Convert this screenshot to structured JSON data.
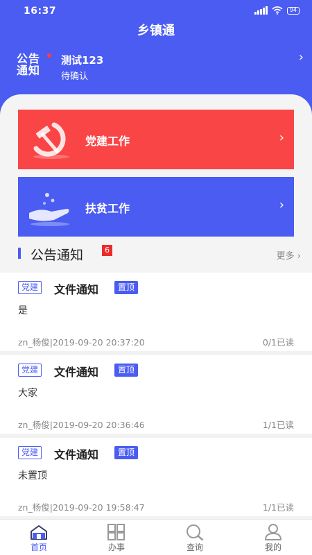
{
  "status_bar": {
    "time": "16:37",
    "battery": "94"
  },
  "header": {
    "title": "乡镇通"
  },
  "notice": {
    "logo_line1": "公告",
    "logo_line2": "通知",
    "title": "测试123",
    "status": "待确认"
  },
  "banners": [
    {
      "label": "党建工作",
      "icon": "hammer-sickle-icon",
      "color": "#fa4546"
    },
    {
      "label": "扶贫工作",
      "icon": "helping-hand-icon",
      "color": "#4a5cf2"
    }
  ],
  "announcements": {
    "title": "公告通知",
    "badge": "6",
    "more": "更多",
    "items": [
      {
        "tag": "党建",
        "title": "文件通知",
        "pin": "置顶",
        "body": "是",
        "meta": "zn_杨俊|2019-09-20 20:37:20",
        "read": "0/1已读"
      },
      {
        "tag": "党建",
        "title": "文件通知",
        "pin": "置顶",
        "body": "大家",
        "meta": "zn_杨俊|2019-09-20 20:36:46",
        "read": "1/1已读"
      },
      {
        "tag": "党建",
        "title": "文件通知",
        "pin": "置顶",
        "body": "未置顶",
        "meta": "zn_杨俊|2019-09-20 19:58:47",
        "read": "1/1已读"
      }
    ]
  },
  "tabs": [
    {
      "label": "首页",
      "icon": "home-icon",
      "active": true
    },
    {
      "label": "办事",
      "icon": "grid-icon",
      "active": false
    },
    {
      "label": "查询",
      "icon": "search-icon",
      "active": false
    },
    {
      "label": "我的",
      "icon": "user-icon",
      "active": false
    }
  ],
  "colors": {
    "primary": "#4a5cf2",
    "party_red": "#fa4546",
    "badge_red": "#ee2b2b"
  }
}
